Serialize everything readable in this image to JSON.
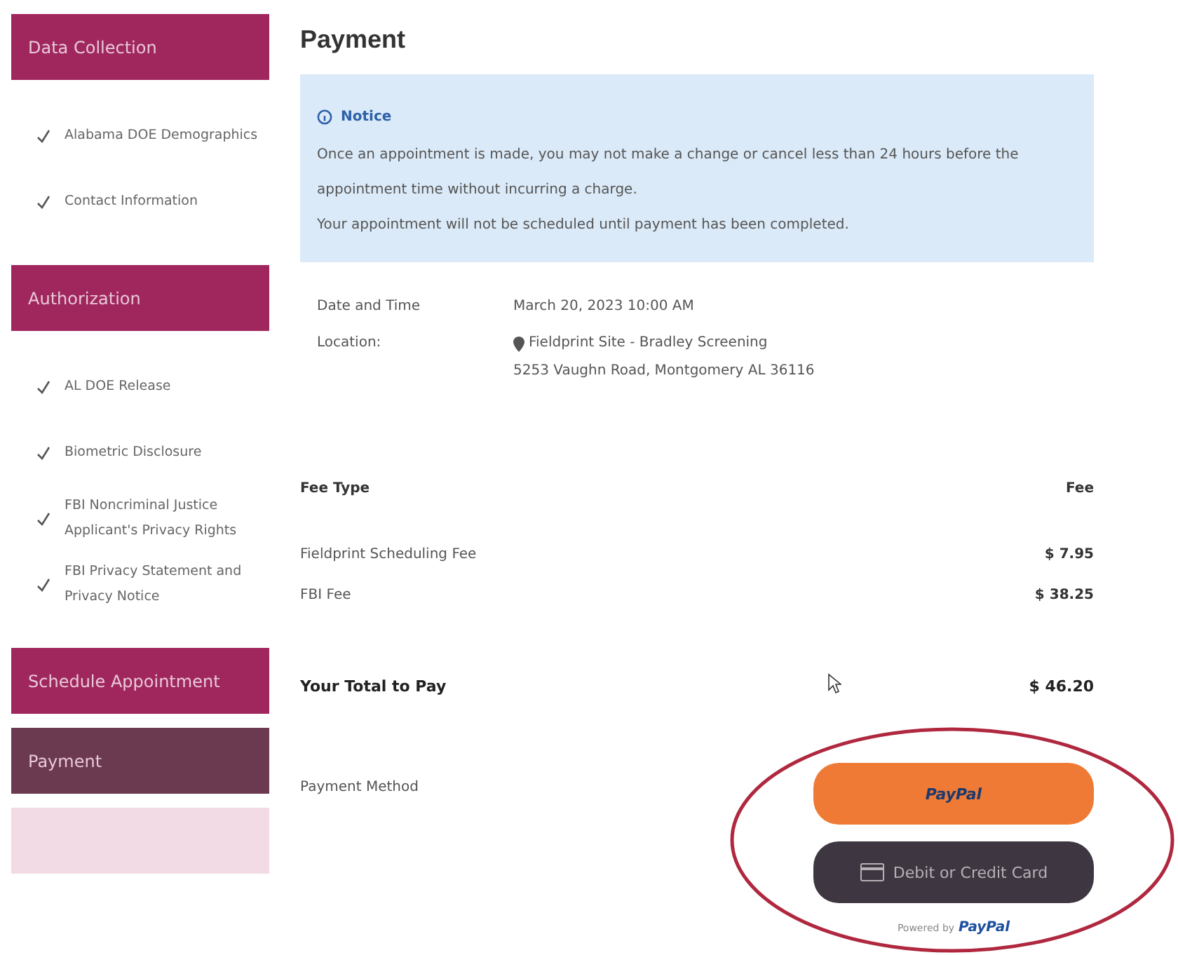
{
  "sidebar": {
    "sections": [
      {
        "label": "Data Collection",
        "selected": false,
        "disabled": false,
        "items": [
          {
            "label": "Alabama DOE Demographics",
            "checked": true
          },
          {
            "label": "Contact Information",
            "checked": true
          }
        ]
      },
      {
        "label": "Authorization",
        "selected": false,
        "disabled": false,
        "items": [
          {
            "label": "AL DOE Release",
            "checked": true
          },
          {
            "label": "Biometric Disclosure",
            "checked": true
          },
          {
            "label": "FBI Noncriminal Justice Applicant's Privacy Rights",
            "checked": true
          },
          {
            "label": "FBI Privacy Statement and Privacy Notice",
            "checked": true
          }
        ]
      },
      {
        "label": "Schedule Appointment",
        "selected": false,
        "disabled": false
      },
      {
        "label": "Payment",
        "selected": true,
        "disabled": false
      },
      {
        "selected": false,
        "disabled": true
      }
    ]
  },
  "page_title": "Payment",
  "notice": {
    "title": "Notice",
    "lines": [
      "Once an appointment is made, you may not make a change or cancel less than 24 hours before the appointment time without incurring a charge.",
      "Your appointment will not be scheduled until payment has been completed."
    ]
  },
  "details": [
    {
      "label": "Date and Time",
      "values": [
        "March 20, 2023 10:00 AM"
      ]
    },
    {
      "label": "Location:",
      "pin": true,
      "values": [
        "Fieldprint Site - Bradley Screening",
        "5253 Vaughn Road,  Montgomery AL 36116"
      ]
    }
  ],
  "fees": {
    "columns": [
      "Fee Type",
      "Fee"
    ],
    "rows": [
      {
        "type": "Fieldprint Scheduling Fee",
        "fee": "$ 7.95"
      },
      {
        "type": "FBI Fee",
        "fee": "$ 38.25"
      }
    ],
    "total_label": "Your Total to Pay",
    "total": "$ 46.20"
  },
  "payment": {
    "label": "Payment Method",
    "paypal_button": "PayPal",
    "card_button": "Debit or Credit Card",
    "powered_by": "Powered by",
    "powered_brand": "PayPal"
  }
}
